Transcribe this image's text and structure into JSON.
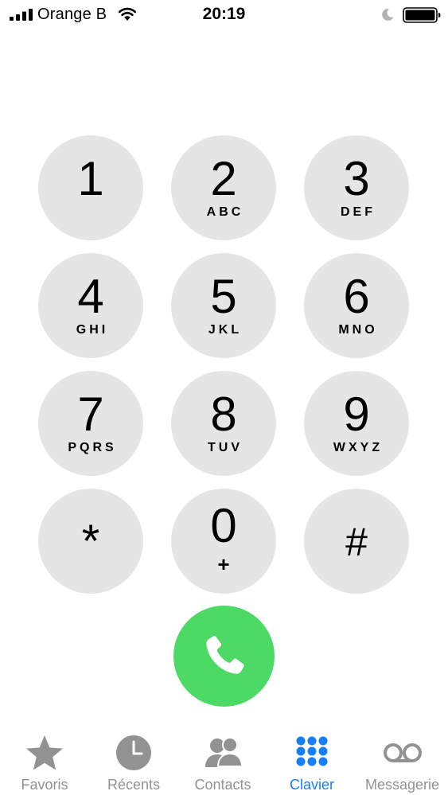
{
  "status_bar": {
    "carrier": "Orange B",
    "time": "20:19",
    "signal_icon": "signal-bars-icon",
    "wifi_icon": "wifi-icon",
    "do_not_disturb_icon": "moon-icon",
    "battery_icon": "battery-icon",
    "battery_level": 1.0
  },
  "keypad": {
    "keys": [
      {
        "digit": "1",
        "letters": ""
      },
      {
        "digit": "2",
        "letters": "ABC"
      },
      {
        "digit": "3",
        "letters": "DEF"
      },
      {
        "digit": "4",
        "letters": "GHI"
      },
      {
        "digit": "5",
        "letters": "JKL"
      },
      {
        "digit": "6",
        "letters": "MNO"
      },
      {
        "digit": "7",
        "letters": "PQRS"
      },
      {
        "digit": "8",
        "letters": "TUV"
      },
      {
        "digit": "9",
        "letters": "WXYZ"
      },
      {
        "digit": "*",
        "letters": ""
      },
      {
        "digit": "0",
        "letters": "+"
      },
      {
        "digit": "#",
        "letters": ""
      }
    ],
    "call_icon": "phone-icon",
    "key_color": "#e5e5e5",
    "call_color": "#4cd964"
  },
  "tab_bar": {
    "active_color": "#147efb",
    "inactive_color": "#929292",
    "tabs": [
      {
        "label": "Favoris",
        "icon": "star-icon",
        "active": false
      },
      {
        "label": "Récents",
        "icon": "clock-icon",
        "active": false
      },
      {
        "label": "Contacts",
        "icon": "contacts-icon",
        "active": false
      },
      {
        "label": "Clavier",
        "icon": "keypad-icon",
        "active": true
      },
      {
        "label": "Messagerie",
        "icon": "voicemail-icon",
        "active": false
      }
    ]
  }
}
